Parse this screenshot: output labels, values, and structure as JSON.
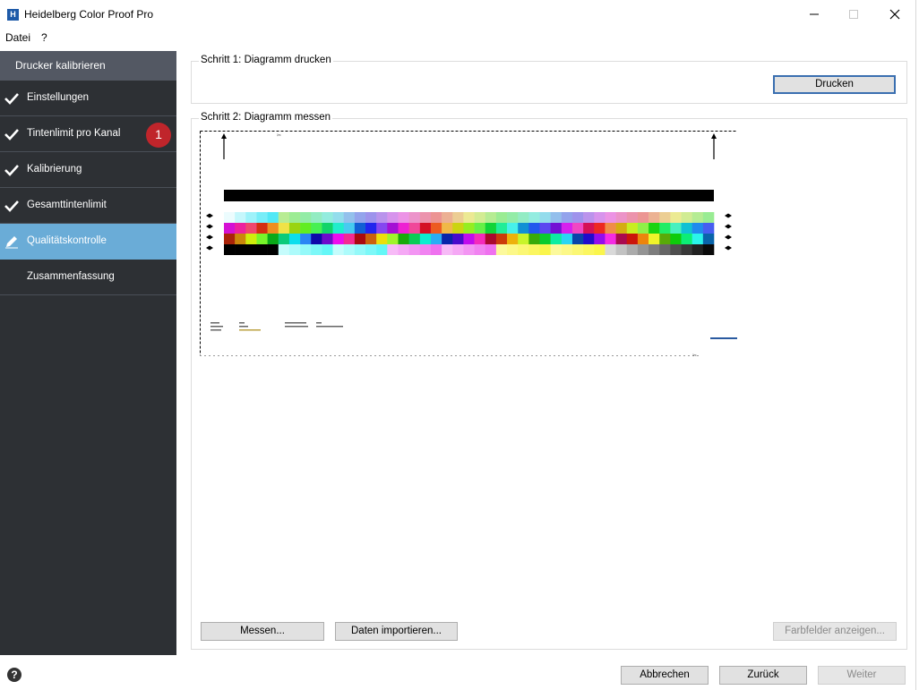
{
  "window": {
    "title": "Heidelberg Color Proof Pro",
    "icon_letter": "H"
  },
  "menu": {
    "items": [
      "Datei",
      "?"
    ]
  },
  "sidebar": {
    "header": "Drucker kalibrieren",
    "items": [
      {
        "label": "Einstellungen",
        "icon": "check-icon"
      },
      {
        "label": "Tintenlimit pro Kanal",
        "icon": "check-icon",
        "badge": "1"
      },
      {
        "label": "Kalibrierung",
        "icon": "check-icon"
      },
      {
        "label": "Gesamttintenlimit",
        "icon": "check-icon"
      },
      {
        "label": "Qualitätskontrolle",
        "icon": "pencil-icon",
        "active": true
      },
      {
        "label": "Zusammenfassung",
        "icon": ""
      }
    ],
    "help": "?"
  },
  "step1": {
    "title": "Schritt 1: Diagramm drucken",
    "print_button": "Drucken"
  },
  "step2": {
    "title": "Schritt 2: Diagramm messen",
    "measure_button": "Messen...",
    "import_button": "Daten importieren...",
    "show_patches_button": "Farbfelder anzeigen..."
  },
  "footer": {
    "cancel": "Abbrechen",
    "back": "Zurück",
    "next": "Weiter"
  },
  "colors": {
    "sidebar_bg": "#2d3034",
    "sidebar_header": "#535863",
    "active": "#6aacd7",
    "badge": "#c0252b"
  }
}
